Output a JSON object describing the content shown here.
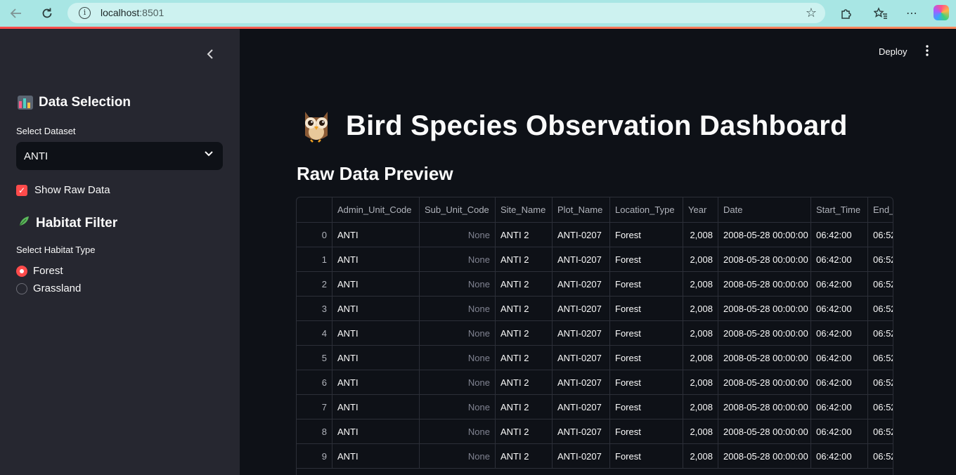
{
  "browser": {
    "url_host": "localhost",
    "url_port": ":8501"
  },
  "sidebar": {
    "data_selection_heading": "Data Selection",
    "select_dataset_label": "Select Dataset",
    "dataset_value": "ANTI",
    "show_raw_label": "Show Raw Data",
    "show_raw_checked": true,
    "habitat_heading": "Habitat Filter",
    "habitat_label": "Select Habitat Type",
    "habitat_options": [
      "Forest",
      "Grassland"
    ],
    "habitat_selected": "Forest"
  },
  "header": {
    "deploy_label": "Deploy"
  },
  "main": {
    "title": "Bird Species Observation Dashboard",
    "subheading": "Raw Data Preview"
  },
  "table": {
    "columns": [
      "",
      "Admin_Unit_Code",
      "Sub_Unit_Code",
      "Site_Name",
      "Plot_Name",
      "Location_Type",
      "Year",
      "Date",
      "Start_Time",
      "End_"
    ],
    "rows": [
      [
        "0",
        "ANTI",
        "None",
        "ANTI 2",
        "ANTI-0207",
        "Forest",
        "2,008",
        "2008-05-28 00:00:00",
        "06:42:00",
        "06:52"
      ],
      [
        "1",
        "ANTI",
        "None",
        "ANTI 2",
        "ANTI-0207",
        "Forest",
        "2,008",
        "2008-05-28 00:00:00",
        "06:42:00",
        "06:52"
      ],
      [
        "2",
        "ANTI",
        "None",
        "ANTI 2",
        "ANTI-0207",
        "Forest",
        "2,008",
        "2008-05-28 00:00:00",
        "06:42:00",
        "06:52"
      ],
      [
        "3",
        "ANTI",
        "None",
        "ANTI 2",
        "ANTI-0207",
        "Forest",
        "2,008",
        "2008-05-28 00:00:00",
        "06:42:00",
        "06:52"
      ],
      [
        "4",
        "ANTI",
        "None",
        "ANTI 2",
        "ANTI-0207",
        "Forest",
        "2,008",
        "2008-05-28 00:00:00",
        "06:42:00",
        "06:52"
      ],
      [
        "5",
        "ANTI",
        "None",
        "ANTI 2",
        "ANTI-0207",
        "Forest",
        "2,008",
        "2008-05-28 00:00:00",
        "06:42:00",
        "06:52"
      ],
      [
        "6",
        "ANTI",
        "None",
        "ANTI 2",
        "ANTI-0207",
        "Forest",
        "2,008",
        "2008-05-28 00:00:00",
        "06:42:00",
        "06:52"
      ],
      [
        "7",
        "ANTI",
        "None",
        "ANTI 2",
        "ANTI-0207",
        "Forest",
        "2,008",
        "2008-05-28 00:00:00",
        "06:42:00",
        "06:52"
      ],
      [
        "8",
        "ANTI",
        "None",
        "ANTI 2",
        "ANTI-0207",
        "Forest",
        "2,008",
        "2008-05-28 00:00:00",
        "06:42:00",
        "06:52"
      ],
      [
        "9",
        "ANTI",
        "None",
        "ANTI 2",
        "ANTI-0207",
        "Forest",
        "2,008",
        "2008-05-28 00:00:00",
        "06:42:00",
        "06:52"
      ]
    ]
  },
  "icons": {
    "back": "arrow-left-icon",
    "reload": "reload-icon",
    "info": "info-icon",
    "favorite": "star-icon",
    "extensions": "puzzle-icon",
    "favorites_bar": "favorites-list-icon",
    "more": "ellipsis-icon",
    "copilot": "copilot-icon",
    "collapse": "chevron-left-icon",
    "chart": "bar-chart-icon",
    "leaf": "leaf-icon",
    "owl": "owl-icon",
    "kebab": "kebab-menu-icon"
  },
  "colors": {
    "accent": "#ff4b4b",
    "sidebar_bg": "#262730",
    "main_bg": "#0e1117",
    "browser_bar": "#a8e6e4"
  }
}
